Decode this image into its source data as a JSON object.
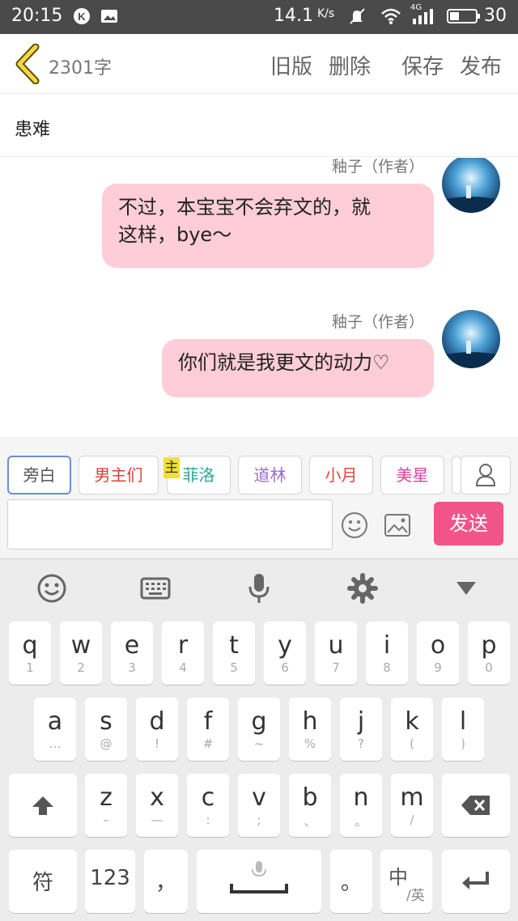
{
  "status": {
    "time": "20:15",
    "speed": "14.1",
    "speed_unit": "K/s",
    "network": "4G",
    "battery": "30"
  },
  "topbar": {
    "count": "2301字",
    "old": "旧版",
    "delete": "删除",
    "save": "保存",
    "publish": "发布"
  },
  "title": "患难",
  "messages": [
    {
      "name": "釉子（作者）",
      "lines": [
        "不过，本宝宝不会弃文的，就",
        "这样，bye～"
      ]
    },
    {
      "name": "釉子（作者）",
      "lines": [
        "你们就是我更文的动力♡"
      ]
    }
  ],
  "tags": [
    {
      "label": "旁白",
      "color": "#555555"
    },
    {
      "label": "男主们",
      "color": "#d9423a"
    },
    {
      "label": "菲洛",
      "color": "#2aa79a"
    },
    {
      "label": "道林",
      "color": "#9a6cc9"
    },
    {
      "label": "小月",
      "color": "#e04a3a"
    },
    {
      "label": "美星",
      "color": "#e0409a"
    }
  ],
  "tag_badge": "主",
  "send": "发送",
  "keyboard": {
    "row1": [
      {
        "k": "q",
        "s": "1"
      },
      {
        "k": "w",
        "s": "2"
      },
      {
        "k": "e",
        "s": "3"
      },
      {
        "k": "r",
        "s": "4"
      },
      {
        "k": "t",
        "s": "5"
      },
      {
        "k": "y",
        "s": "6"
      },
      {
        "k": "u",
        "s": "7"
      },
      {
        "k": "i",
        "s": "8"
      },
      {
        "k": "o",
        "s": "9"
      },
      {
        "k": "p",
        "s": "0"
      }
    ],
    "row2": [
      {
        "k": "a",
        "s": "…"
      },
      {
        "k": "s",
        "s": "@"
      },
      {
        "k": "d",
        "s": "!"
      },
      {
        "k": "f",
        "s": "#"
      },
      {
        "k": "g",
        "s": "~"
      },
      {
        "k": "h",
        "s": "%"
      },
      {
        "k": "j",
        "s": "?"
      },
      {
        "k": "k",
        "s": "("
      },
      {
        "k": "l",
        "s": ")"
      }
    ],
    "row3": [
      {
        "k": "z",
        "s": "–"
      },
      {
        "k": "x",
        "s": "—"
      },
      {
        "k": "c",
        "s": ":"
      },
      {
        "k": "v",
        "s": ";"
      },
      {
        "k": "b",
        "s": "、"
      },
      {
        "k": "n",
        "s": "。"
      },
      {
        "k": "m",
        "s": "/"
      }
    ],
    "symbols": "符",
    "numbers": "123",
    "comma": "，",
    "period": "。",
    "lang_main": "中",
    "lang_sub": "/英"
  }
}
